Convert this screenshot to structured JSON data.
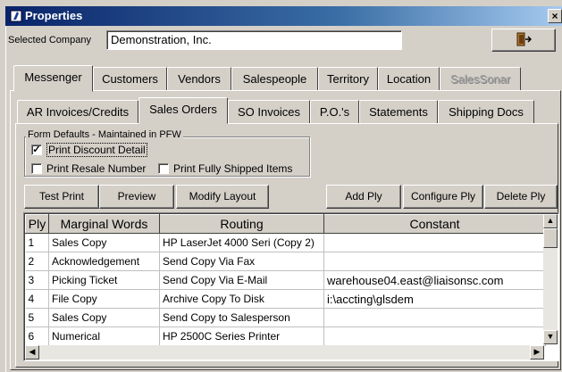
{
  "window": {
    "title": "Properties",
    "close_glyph": "×"
  },
  "company": {
    "label": "Selected Company",
    "value": "Demonstration, Inc.",
    "exit_icon": "exit-door-icon"
  },
  "main_tabs": [
    {
      "label": "Messenger"
    },
    {
      "label": "Customers"
    },
    {
      "label": "Vendors"
    },
    {
      "label": "Salespeople"
    },
    {
      "label": "Territory"
    },
    {
      "label": "Location"
    },
    {
      "label": "SalesSonar"
    }
  ],
  "sub_tabs": [
    {
      "label": "AR Invoices/Credits"
    },
    {
      "label": "Sales Orders"
    },
    {
      "label": "SO Invoices"
    },
    {
      "label": "P.O.'s"
    },
    {
      "label": "Statements"
    },
    {
      "label": "Shipping Docs"
    }
  ],
  "form_defaults": {
    "title": "Form Defaults - Maintained in PFW",
    "print_discount_detail": {
      "label": "Print Discount Detail",
      "checked": true
    },
    "print_resale_number": {
      "label": "Print Resale Number",
      "checked": false
    },
    "print_fully_shipped": {
      "label": "Print Fully Shipped Items",
      "checked": false
    }
  },
  "buttons": {
    "test_print": "Test Print",
    "preview": "Preview",
    "modify_layout": "Modify Layout",
    "add_ply": "Add Ply",
    "configure_ply": "Configure Ply",
    "delete_ply": "Delete Ply"
  },
  "grid": {
    "columns": [
      "Ply",
      "Marginal Words",
      "Routing",
      "Constant"
    ],
    "rows": [
      [
        "1",
        "Sales Copy",
        "HP LaserJet 4000 Seri (Copy 2)",
        ""
      ],
      [
        "2",
        "Acknowledgement",
        "Send Copy Via Fax",
        ""
      ],
      [
        "3",
        "Picking Ticket",
        "Send Copy Via E-Mail",
        "warehouse04.east@liaisonsc.com"
      ],
      [
        "4",
        "File Copy",
        "Archive Copy To Disk",
        "i:\\accting\\glsdem"
      ],
      [
        "5",
        "Sales Copy",
        "Send Copy to Salesperson",
        ""
      ],
      [
        "6",
        "Numerical",
        "HP 2500C Series Printer",
        ""
      ]
    ]
  },
  "colors": {
    "title_start": "#0a246a",
    "title_end": "#a6caf0",
    "face": "#d4d0c8"
  }
}
